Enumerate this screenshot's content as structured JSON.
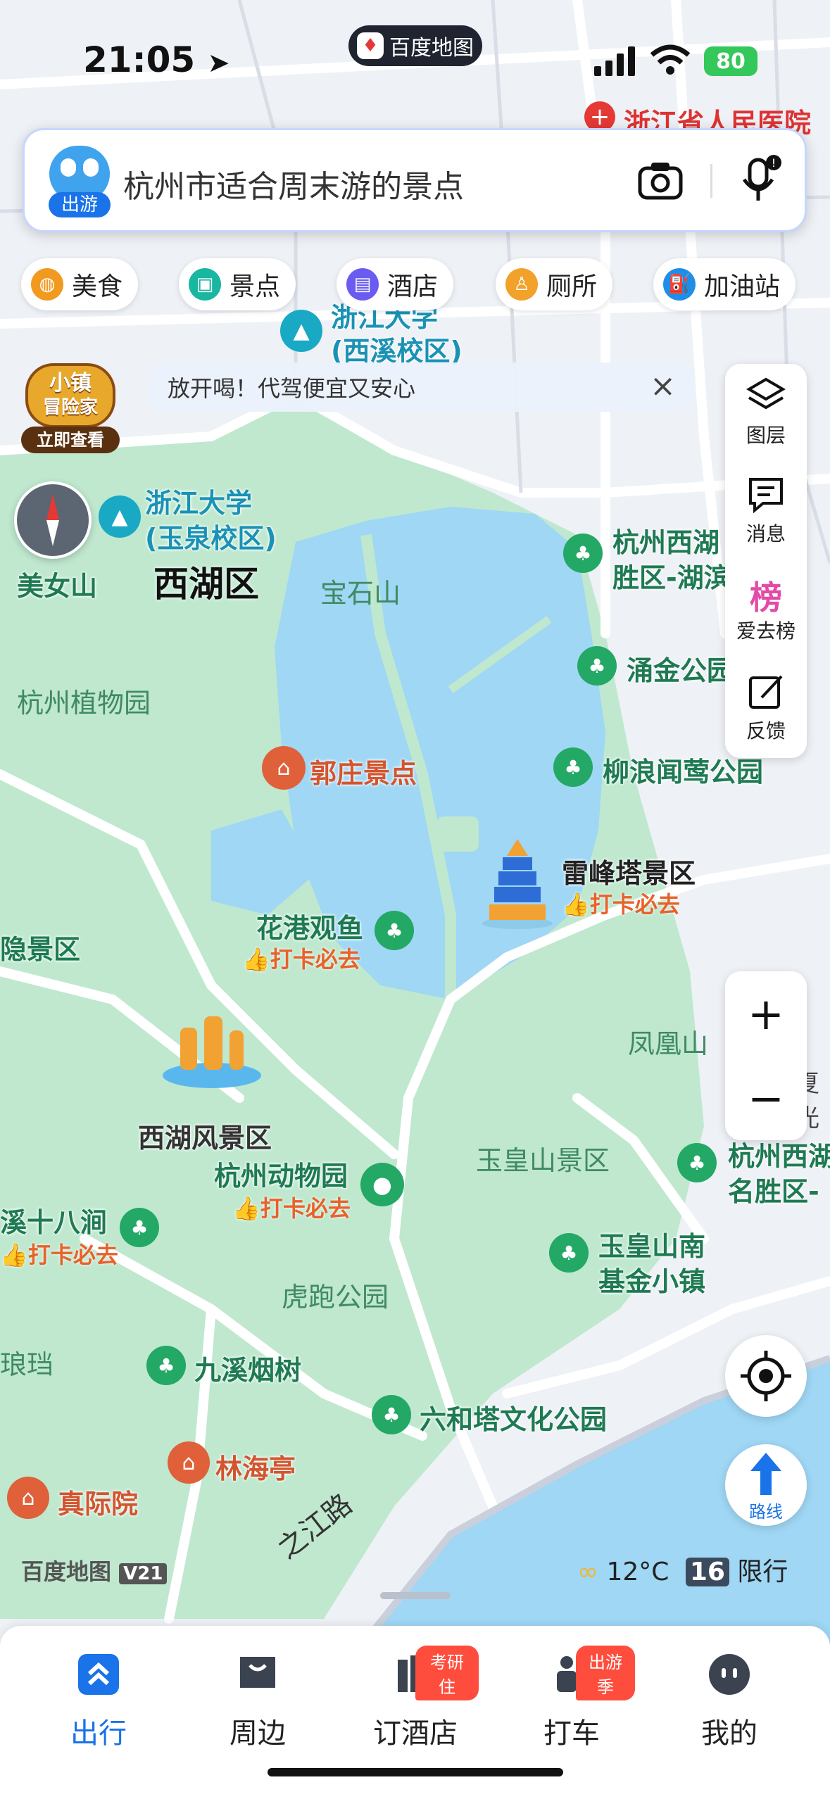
{
  "status_bar": {
    "time": "21:05",
    "app_pill": "百度地图",
    "battery": "80"
  },
  "search": {
    "mode_badge": "出游",
    "placeholder": "杭州市适合周末游的景点"
  },
  "quick_chips": [
    {
      "label": "美食",
      "icon": "food-icon",
      "color": "#f29a1f"
    },
    {
      "label": "景点",
      "icon": "scenic-icon",
      "color": "#19b6a0"
    },
    {
      "label": "酒店",
      "icon": "hotel-icon",
      "color": "#6a5cf0"
    },
    {
      "label": "厕所",
      "icon": "toilet-icon",
      "color": "#f2a22a"
    },
    {
      "label": "加油站",
      "icon": "gas-station-icon",
      "color": "#1e8fe8"
    }
  ],
  "promo": {
    "line1": "小镇",
    "line2": "冒险家",
    "button": "立即查看"
  },
  "banner": {
    "text": "放开喝！代驾便宜又安心"
  },
  "side_panel": [
    {
      "label": "图层",
      "icon": "layers-icon"
    },
    {
      "label": "消息",
      "icon": "message-icon"
    },
    {
      "label": "爱去榜",
      "icon": "ranking-icon",
      "glyph": "榜"
    },
    {
      "label": "反馈",
      "icon": "feedback-icon"
    }
  ],
  "zoom": {
    "in": "+",
    "out": "−"
  },
  "route_label": "路线",
  "weather": {
    "temp": "12°C",
    "limit_digits": "16",
    "limit_text": "限行"
  },
  "watermark": "百度地图",
  "watermark_version": "V21",
  "map": {
    "district": "西湖区",
    "labels": {
      "hospital": "浙江省人民医院",
      "zju_xixi": "浙江大学",
      "zju_xixi_sub": "(西溪校区)",
      "zju_yuquan": "浙江大学",
      "zju_yuquan_sub": "(玉泉校区)",
      "meinvshan": "美女山",
      "baoshishan": "宝石山",
      "botanical": "杭州植物园",
      "guozhuang": "郭庄景点",
      "leifeng": "雷峰塔景区",
      "huagang": "花港观鱼",
      "lingyin": "隐景区",
      "xihu_scenic": "西湖风景区",
      "zoo": "杭州动物园",
      "shibajian": "溪十八涧",
      "hupao": "虎跑公园",
      "langdang": "琅珰",
      "jiuxi": "九溪烟树",
      "linhai": "林海亭",
      "zhenji": "真际院",
      "liuhe": "六和塔文化公园",
      "yuhuang_scenic": "玉皇山景区",
      "yuhuang_nan": "玉皇山南",
      "yuhuang_nan2": "基金小镇",
      "fenghuang": "凤凰山",
      "liulang": "柳浪闻莺公园",
      "yongjin": "涌金公园",
      "xihu_mingsheng": "杭州西湖",
      "xihu_mingsheng2": "胜区-湖滨",
      "xihu_mingsheng_b": "杭州西湖",
      "xihu_mingsheng_b2": "名胜区-",
      "zhijiang": "之江路",
      "xiazhu": "夏光",
      "tag": "打卡必去"
    }
  },
  "tabs": [
    {
      "label": "出行",
      "icon": "travel-icon",
      "active": true
    },
    {
      "label": "周边",
      "icon": "nearby-icon"
    },
    {
      "label": "订酒店",
      "icon": "hotel-booking-icon",
      "badge": "考研住"
    },
    {
      "label": "打车",
      "icon": "taxi-icon",
      "badge": "出游季"
    },
    {
      "label": "我的",
      "icon": "profile-icon"
    }
  ],
  "colors": {
    "water": "#9fd7f5",
    "green": "#bfe8cf",
    "accent": "#1a73e8",
    "tag": "#e8622a",
    "road": "#ffffff"
  }
}
